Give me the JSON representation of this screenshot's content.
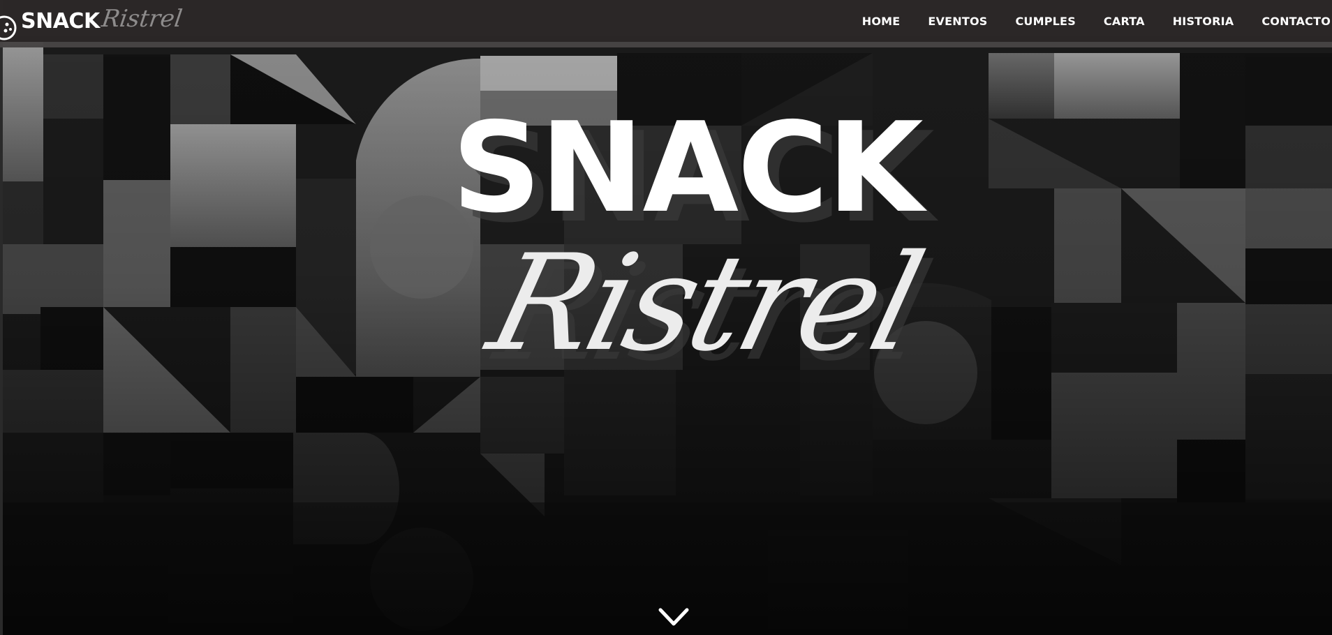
{
  "brand": {
    "snack": "SNACK",
    "script": "Ristrel",
    "logo_icon": "cookie-icon"
  },
  "nav": {
    "items": [
      {
        "label": "HOME"
      },
      {
        "label": "EVENTOS"
      },
      {
        "label": "CUMPLES"
      },
      {
        "label": "CARTA"
      },
      {
        "label": "HISTORIA"
      },
      {
        "label": "CONTACTO"
      }
    ]
  },
  "hero": {
    "title": "SNACK",
    "script": "Ristrel",
    "scroll_icon": "chevron-down-icon"
  },
  "colors": {
    "topbar": "#2c2828",
    "title": "#ffffff",
    "script": "#ececec",
    "logo_script": "#8d8b8b"
  }
}
